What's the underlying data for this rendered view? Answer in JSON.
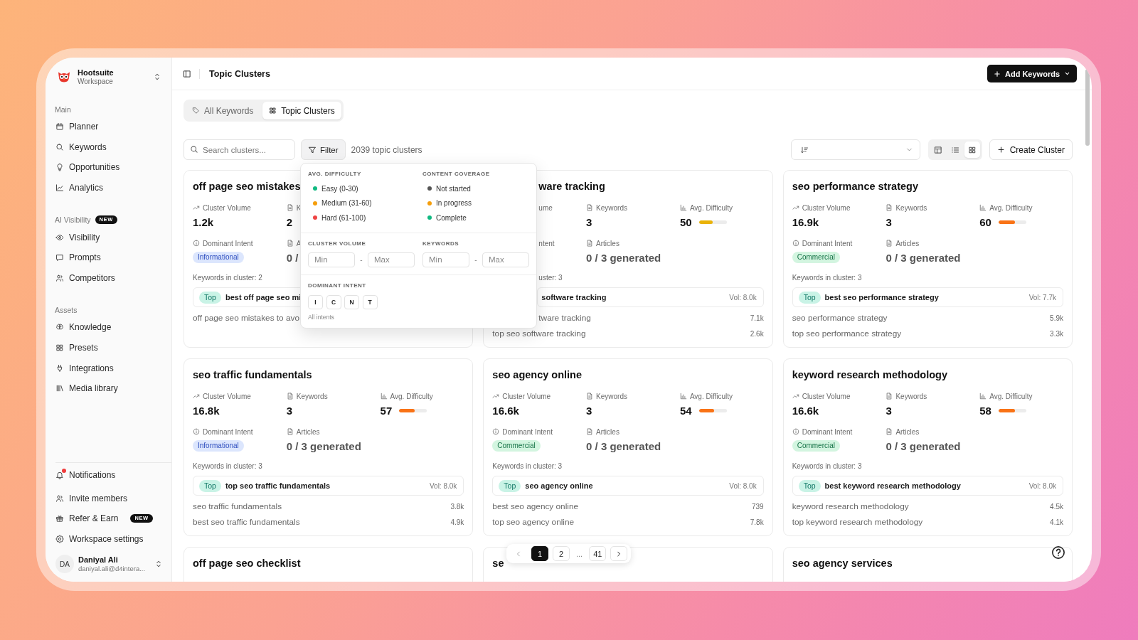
{
  "sidebar": {
    "workspace": {
      "name": "Hootsuite",
      "subtitle": "Workspace"
    },
    "sections": [
      {
        "label": "Main",
        "items": [
          {
            "label": "Planner",
            "selected": false
          },
          {
            "label": "Keywords",
            "selected": false
          },
          {
            "label": "Opportunities",
            "selected": false
          },
          {
            "label": "Analytics",
            "selected": false
          }
        ]
      },
      {
        "label": "AI Visibility",
        "badge": "NEW",
        "items": [
          {
            "label": "Visibility",
            "selected": false
          },
          {
            "label": "Prompts",
            "selected": false
          },
          {
            "label": "Competitors",
            "selected": false
          }
        ]
      },
      {
        "label": "Assets",
        "items": [
          {
            "label": "Knowledge",
            "selected": false
          },
          {
            "label": "Presets",
            "selected": false
          },
          {
            "label": "Integrations",
            "selected": false
          },
          {
            "label": "Media library",
            "selected": false
          }
        ]
      }
    ],
    "bottom": [
      {
        "label": "Notifications",
        "unread": true,
        "selected": false
      },
      {
        "label": "Invite members",
        "selected": false
      },
      {
        "label": "Refer & Earn",
        "badge": "NEW",
        "selected": false
      },
      {
        "label": "Workspace settings",
        "selected": false
      }
    ],
    "user": {
      "initials": "DA",
      "name": "Daniyal Ali",
      "email": "daniyal.ali@d4intera..."
    }
  },
  "topbar": {
    "title": "Topic Clusters",
    "button": "Add Keywords"
  },
  "tabs": [
    {
      "label": "All Keywords",
      "selected": false
    },
    {
      "label": "Topic Clusters",
      "selected": true
    }
  ],
  "toolbar": {
    "search": {
      "placeholder": "Search clusters..."
    },
    "filter": {
      "label": "Filter",
      "open": true,
      "panel": {
        "groups": [
          {
            "heading": "AVG. DIFFICULTY",
            "options": [
              {
                "label": "Easy (0-30)",
                "color": "#10b981",
                "selected": false
              },
              {
                "label": "Medium (31-60)",
                "color": "#f59e0b",
                "selected": false
              },
              {
                "label": "Hard (61-100)",
                "color": "#ef4444",
                "selected": false
              }
            ]
          },
          {
            "heading": "CONTENT COVERAGE",
            "options": [
              {
                "label": "Not started",
                "color": "#555555",
                "selected": false
              },
              {
                "label": "In progress",
                "color": "#f59e0b",
                "selected": false
              },
              {
                "label": "Complete",
                "color": "#10b981",
                "selected": false
              }
            ]
          }
        ],
        "ranges": [
          {
            "heading": "CLUSTER VOLUME",
            "min": {
              "placeholder": "Min"
            },
            "separator": "-",
            "max": {
              "placeholder": "Max"
            }
          },
          {
            "heading": "KEYWORDS",
            "min": {
              "placeholder": "Min"
            },
            "separator": "-",
            "max": {
              "placeholder": "Max"
            }
          }
        ],
        "intent": {
          "heading": "DOMINANT INTENT",
          "options": [
            {
              "label": "I",
              "selected": false
            },
            {
              "label": "C",
              "selected": false
            },
            {
              "label": "N",
              "selected": false
            },
            {
              "label": "T",
              "selected": false
            }
          ],
          "note": "All intents"
        }
      }
    },
    "count": "2039 topic clusters",
    "views": [
      {
        "selected": false
      },
      {
        "selected": false
      },
      {
        "selected": true
      }
    ],
    "create": "Create Cluster"
  },
  "cards": [
    {
      "title": "off page seo mistakes",
      "stats": [
        {
          "kind": "volume",
          "label": "Cluster Volume",
          "value": "1.2k"
        },
        {
          "kind": "count",
          "label": "K",
          "value": "2"
        }
      ],
      "intent": {
        "label": "Dominant Intent",
        "value": "Informational",
        "kind": "informational"
      },
      "articles": {
        "label": "A",
        "value": "0 /"
      },
      "count": "Keywords in cluster: 2",
      "top": {
        "badge": "Top",
        "keyword": "best off page seo mi"
      },
      "keywords": [
        {
          "keyword": "off page seo mistakes to avo"
        }
      ]
    },
    {
      "title": "ware tracking",
      "stats": [
        {
          "kind": "volume",
          "label": "ume"
        },
        {
          "kind": "count",
          "label": "Keywords",
          "value": "3"
        },
        {
          "kind": "difficulty",
          "label": "Avg. Difficulty",
          "value": "50",
          "level": 0.5,
          "color": "#eab308"
        }
      ],
      "intent": {
        "label": "ntent"
      },
      "articles": {
        "label": "Articles",
        "value": "0 / 3 generated"
      },
      "count": "uster: 3",
      "top": {
        "keyword": "software tracking",
        "vol": "Vol: 8.0k"
      },
      "keywords": [
        {
          "keyword": "tware tracking",
          "vol": "7.1k"
        },
        {
          "keyword": "top seo software tracking",
          "vol": "2.6k"
        }
      ]
    },
    {
      "title": "seo performance strategy",
      "stats": [
        {
          "kind": "volume",
          "label": "Cluster Volume",
          "value": "16.9k"
        },
        {
          "kind": "count",
          "label": "Keywords",
          "value": "3"
        },
        {
          "kind": "difficulty",
          "label": "Avg. Difficulty",
          "value": "60",
          "level": 0.6,
          "color": "#f97316"
        }
      ],
      "intent": {
        "label": "Dominant Intent",
        "value": "Commercial",
        "kind": "commercial"
      },
      "articles": {
        "label": "Articles",
        "value": "0 / 3 generated"
      },
      "count": "Keywords in cluster: 3",
      "top": {
        "badge": "Top",
        "keyword": "best seo performance strategy",
        "vol": "Vol: 7.7k"
      },
      "keywords": [
        {
          "keyword": "seo performance strategy",
          "vol": "5.9k"
        },
        {
          "keyword": "top seo performance strategy",
          "vol": "3.3k"
        }
      ]
    },
    {
      "title": "seo traffic fundamentals",
      "stats": [
        {
          "kind": "volume",
          "label": "Cluster Volume",
          "value": "16.8k"
        },
        {
          "kind": "count",
          "label": "Keywords",
          "value": "3"
        },
        {
          "kind": "difficulty",
          "label": "Avg. Difficulty",
          "value": "57",
          "level": 0.57,
          "color": "#f97316"
        }
      ],
      "intent": {
        "label": "Dominant Intent",
        "value": "Informational",
        "kind": "informational"
      },
      "articles": {
        "label": "Articles",
        "value": "0 / 3 generated"
      },
      "count": "Keywords in cluster: 3",
      "top": {
        "badge": "Top",
        "keyword": "top seo traffic fundamentals",
        "vol": "Vol: 8.0k"
      },
      "keywords": [
        {
          "keyword": "seo traffic fundamentals",
          "vol": "3.8k"
        },
        {
          "keyword": "best seo traffic fundamentals",
          "vol": "4.9k"
        }
      ]
    },
    {
      "title": "seo agency online",
      "stats": [
        {
          "kind": "volume",
          "label": "Cluster Volume",
          "value": "16.6k"
        },
        {
          "kind": "count",
          "label": "Keywords",
          "value": "3"
        },
        {
          "kind": "difficulty",
          "label": "Avg. Difficulty",
          "value": "54",
          "level": 0.54,
          "color": "#f97316"
        }
      ],
      "intent": {
        "label": "Dominant Intent",
        "value": "Commercial",
        "kind": "commercial"
      },
      "articles": {
        "label": "Articles",
        "value": "0 / 3 generated"
      },
      "count": "Keywords in cluster: 3",
      "top": {
        "badge": "Top",
        "keyword": "seo agency online",
        "vol": "Vol: 8.0k"
      },
      "keywords": [
        {
          "keyword": "best seo agency online",
          "vol": "739"
        },
        {
          "keyword": "top seo agency online",
          "vol": "7.8k"
        }
      ]
    },
    {
      "title": "keyword research methodology",
      "stats": [
        {
          "kind": "volume",
          "label": "Cluster Volume",
          "value": "16.6k"
        },
        {
          "kind": "count",
          "label": "Keywords",
          "value": "3"
        },
        {
          "kind": "difficulty",
          "label": "Avg. Difficulty",
          "value": "58",
          "level": 0.58,
          "color": "#f97316"
        }
      ],
      "intent": {
        "label": "Dominant Intent",
        "value": "Commercial",
        "kind": "commercial"
      },
      "articles": {
        "label": "Articles",
        "value": "0 / 3 generated"
      },
      "count": "Keywords in cluster: 3",
      "top": {
        "badge": "Top",
        "keyword": "best keyword research methodology",
        "vol": "Vol: 8.0k"
      },
      "keywords": [
        {
          "keyword": "keyword research methodology",
          "vol": "4.5k"
        },
        {
          "keyword": "top keyword research methodology",
          "vol": "4.1k"
        }
      ]
    },
    {
      "title": "off page seo checklist"
    },
    {
      "title": "se"
    },
    {
      "title": "seo agency services"
    }
  ],
  "pagination": {
    "prev": {
      "disabled": true
    },
    "next": {
      "disabled": false
    },
    "pages": [
      {
        "kind": "page",
        "label": "1",
        "selected": true
      },
      {
        "kind": "page",
        "label": "2",
        "selected": false
      },
      {
        "kind": "gap",
        "label": "...",
        "selected": false
      },
      {
        "kind": "page",
        "label": "41",
        "selected": false
      }
    ]
  }
}
